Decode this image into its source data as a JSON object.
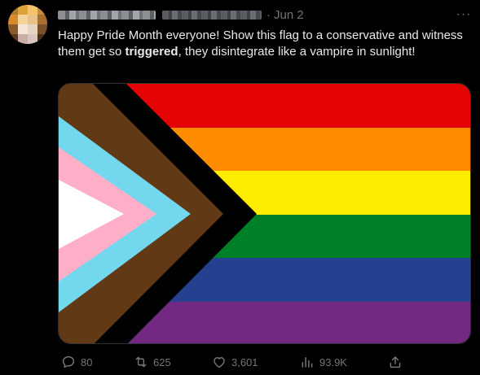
{
  "tweet": {
    "date": "Jun 2",
    "dot": "·",
    "more_label": "···",
    "text_before": "Happy Pride Month everyone! Show this flag to a conservative and witness them get so ",
    "text_bold": "triggered",
    "text_after": ", they disintegrate like a vampire in sunlight!"
  },
  "actions": {
    "replies": "80",
    "retweets": "625",
    "likes": "3,601",
    "views": "93.9K"
  },
  "icons": {
    "reply": "reply-bubble-icon",
    "retweet": "retweet-icon",
    "like": "heart-icon",
    "views": "views-bar-chart-icon",
    "share": "share-upload-icon"
  },
  "colors": {
    "background": "#000000",
    "text": "#e7e9ea",
    "muted": "#71767b",
    "flag_red": "#e40303",
    "flag_orange": "#ff8c00",
    "flag_yellow": "#ffed00",
    "flag_green": "#008026",
    "flag_blue": "#24408e",
    "flag_purple": "#732982",
    "flag_black": "#000000",
    "flag_brown": "#613915",
    "flag_light_blue": "#73d7ee",
    "flag_pink": "#ffafc7",
    "flag_white": "#ffffff"
  }
}
